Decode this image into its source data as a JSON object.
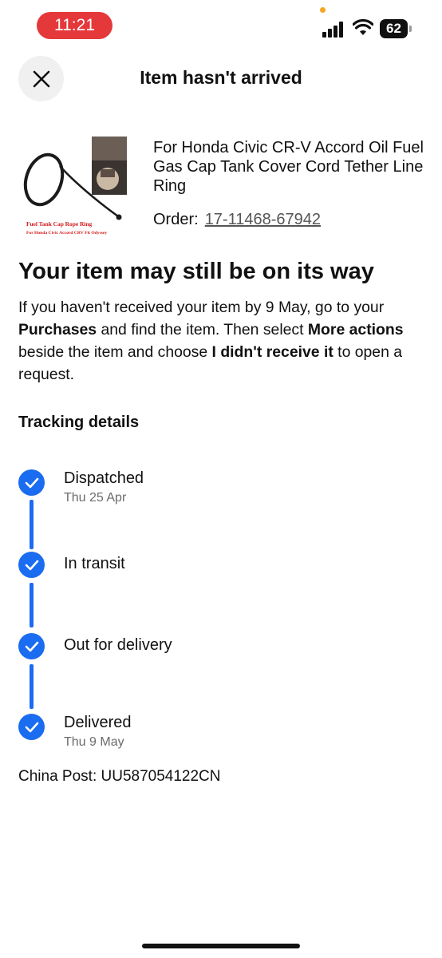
{
  "status_bar": {
    "time": "11:21",
    "battery": "62"
  },
  "header": {
    "title": "Item hasn't arrived",
    "close_icon": "close-icon"
  },
  "product": {
    "image_caption_line1": "Fuel Tank Cap Rope Ring",
    "image_caption_line2": "For Honda Civic Accord CRV Fit Odyssey",
    "title": "For Honda Civic CR-V Accord Oil Fuel Gas Cap Tank Cover Cord Tether Line Ring",
    "order_label": "Order:",
    "order_number": "17-11468-67942"
  },
  "info": {
    "headline": "Your item may still be on its way",
    "text_1": "If you haven't received your item by 9 May, go to your ",
    "bold_1": "Purchases",
    "text_2": " and find the item. Then select ",
    "bold_2": "More actions",
    "text_3": " beside the item and choose ",
    "bold_3": "I didn't receive it",
    "text_4": " to open a request."
  },
  "tracking": {
    "title": "Tracking details",
    "steps": [
      {
        "label": "Dispatched",
        "date": "Thu 25 Apr"
      },
      {
        "label": "In transit",
        "date": ""
      },
      {
        "label": "Out for delivery",
        "date": ""
      },
      {
        "label": "Delivered",
        "date": "Thu 9 May"
      }
    ],
    "carrier": "China Post: UU587054122CN"
  },
  "colors": {
    "accent_blue": "#1a6cf0",
    "time_pill": "#e5383b"
  }
}
